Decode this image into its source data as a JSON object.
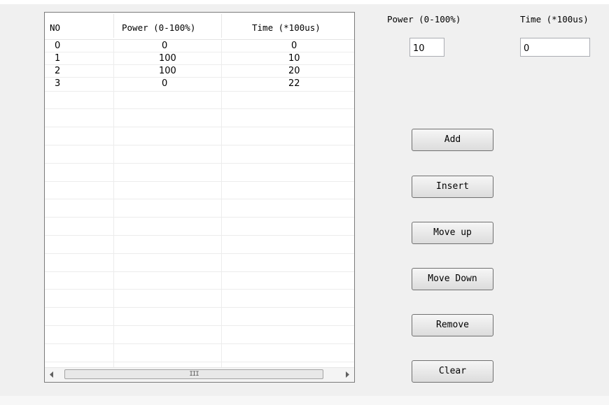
{
  "table": {
    "columns": [
      "NO",
      "Power (0-100%)",
      "Time (*100us)"
    ],
    "rows": [
      {
        "no": "0",
        "power": "0",
        "time": "0"
      },
      {
        "no": "1",
        "power": "100",
        "time": "10"
      },
      {
        "no": "2",
        "power": "100",
        "time": "20"
      },
      {
        "no": "3",
        "power": "0",
        "time": "22"
      }
    ],
    "scrollbar_grip": "III"
  },
  "inputs": {
    "power_label": "Power (0-100%)",
    "power_value": "10",
    "time_label": "Time (*100us)",
    "time_value": "0"
  },
  "buttons": {
    "add": "Add",
    "insert": "Insert",
    "move_up": "Move up",
    "move_down": "Move Down",
    "remove": "Remove",
    "clear": "Clear"
  }
}
